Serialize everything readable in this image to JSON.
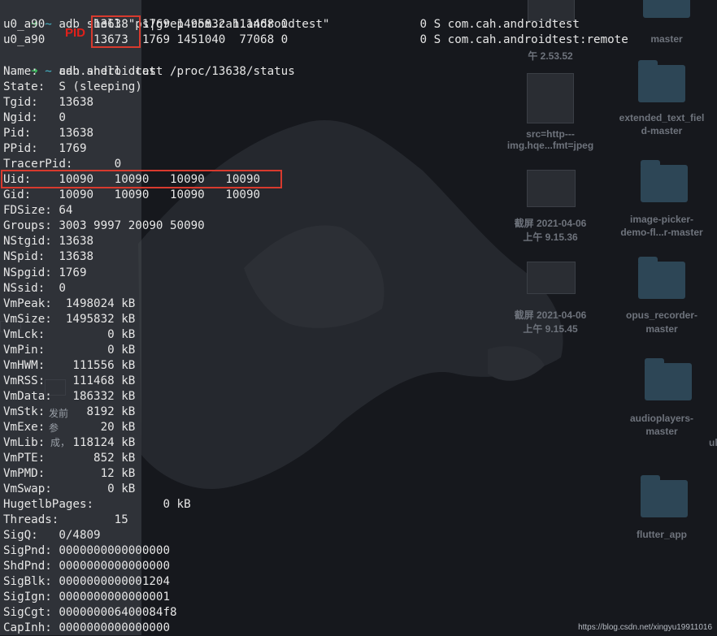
{
  "desktop": {
    "items": [
      {
        "kind": "file",
        "label1": "master",
        "label2": "午 2.53.52"
      },
      {
        "kind": "folder",
        "label1": "",
        "label2": ""
      },
      {
        "kind": "file",
        "label1": "src=http---",
        "label2": "img.hqe...fmt=jpeg"
      },
      {
        "kind": "folder",
        "label1": "extended_text_fiel",
        "label2": "d-master"
      },
      {
        "kind": "file",
        "label1": "截屏 2021-04-06",
        "label2": "上午 9.15.36"
      },
      {
        "kind": "folder",
        "label1": "image-picker-",
        "label2": "demo-fl...r-master"
      },
      {
        "kind": "file",
        "label1": "截屏 2021-04-06",
        "label2": "上午 9.15.45"
      },
      {
        "kind": "folder",
        "label1": "opus_recorder-",
        "label2": "master"
      },
      {
        "kind": "folder",
        "label1": "audioplayers-",
        "label2": "master"
      },
      {
        "kind": "folder",
        "label1": "flutter_app",
        "label2": ""
      }
    ],
    "edge_label": "ul",
    "stray_text": [
      "发前",
      "参",
      "成，"
    ]
  },
  "terminal": {
    "cmd1": {
      "arrow": "➜",
      "tilde": "~",
      "text": " adb shell \"ps|grep com.cah.androidtest\""
    },
    "ps_rows": [
      {
        "text": "u0_a90       13638  1769 1495832 111468 0                   0 S com.cah.androidtest"
      },
      {
        "text": "u0_a90       13673  1769 1451040  77068 0                   0 S com.cah.androidtest:remote"
      }
    ],
    "pid_label": "PID",
    "cmd2": {
      "arrow": "➜",
      "tilde": "~",
      "text": " adb shell  cat  /proc/13638/status"
    },
    "status_lines": [
      "Name:   cah.androidtest",
      "State:  S (sleeping)",
      "Tgid:   13638",
      "Ngid:   0",
      "Pid:    13638",
      "PPid:   1769",
      "TracerPid:      0",
      "Uid:    10090   10090   10090   10090",
      "Gid:    10090   10090   10090   10090",
      "FDSize: 64",
      "Groups: 3003 9997 20090 50090",
      "NStgid: 13638",
      "NSpid:  13638",
      "NSpgid: 1769",
      "NSsid:  0",
      "VmPeak:  1498024 kB",
      "VmSize:  1495832 kB",
      "VmLck:         0 kB",
      "VmPin:         0 kB",
      "VmHWM:    111556 kB",
      "VmRSS:    111468 kB",
      "VmData:   186332 kB",
      "VmStk:      8192 kB",
      "VmExe:        20 kB",
      "VmLib:    118124 kB",
      "VmPTE:       852 kB",
      "VmPMD:        12 kB",
      "VmSwap:        0 kB",
      "HugetlbPages:          0 kB",
      "Threads:        15",
      "SigQ:   0/4809",
      "SigPnd: 0000000000000000",
      "ShdPnd: 0000000000000000",
      "SigBlk: 0000000000001204",
      "SigIgn: 0000000000000001",
      "SigCgt: 000000006400084f8",
      "CapInh: 0000000000000000"
    ]
  },
  "watermark": "https://blog.csdn.net/xingyu19911016",
  "colors": {
    "prompt_arrow": "#38c25c",
    "prompt_tilde": "#45b6c9",
    "highlight": "#d83a2e",
    "pid_label": "#e0201a"
  }
}
